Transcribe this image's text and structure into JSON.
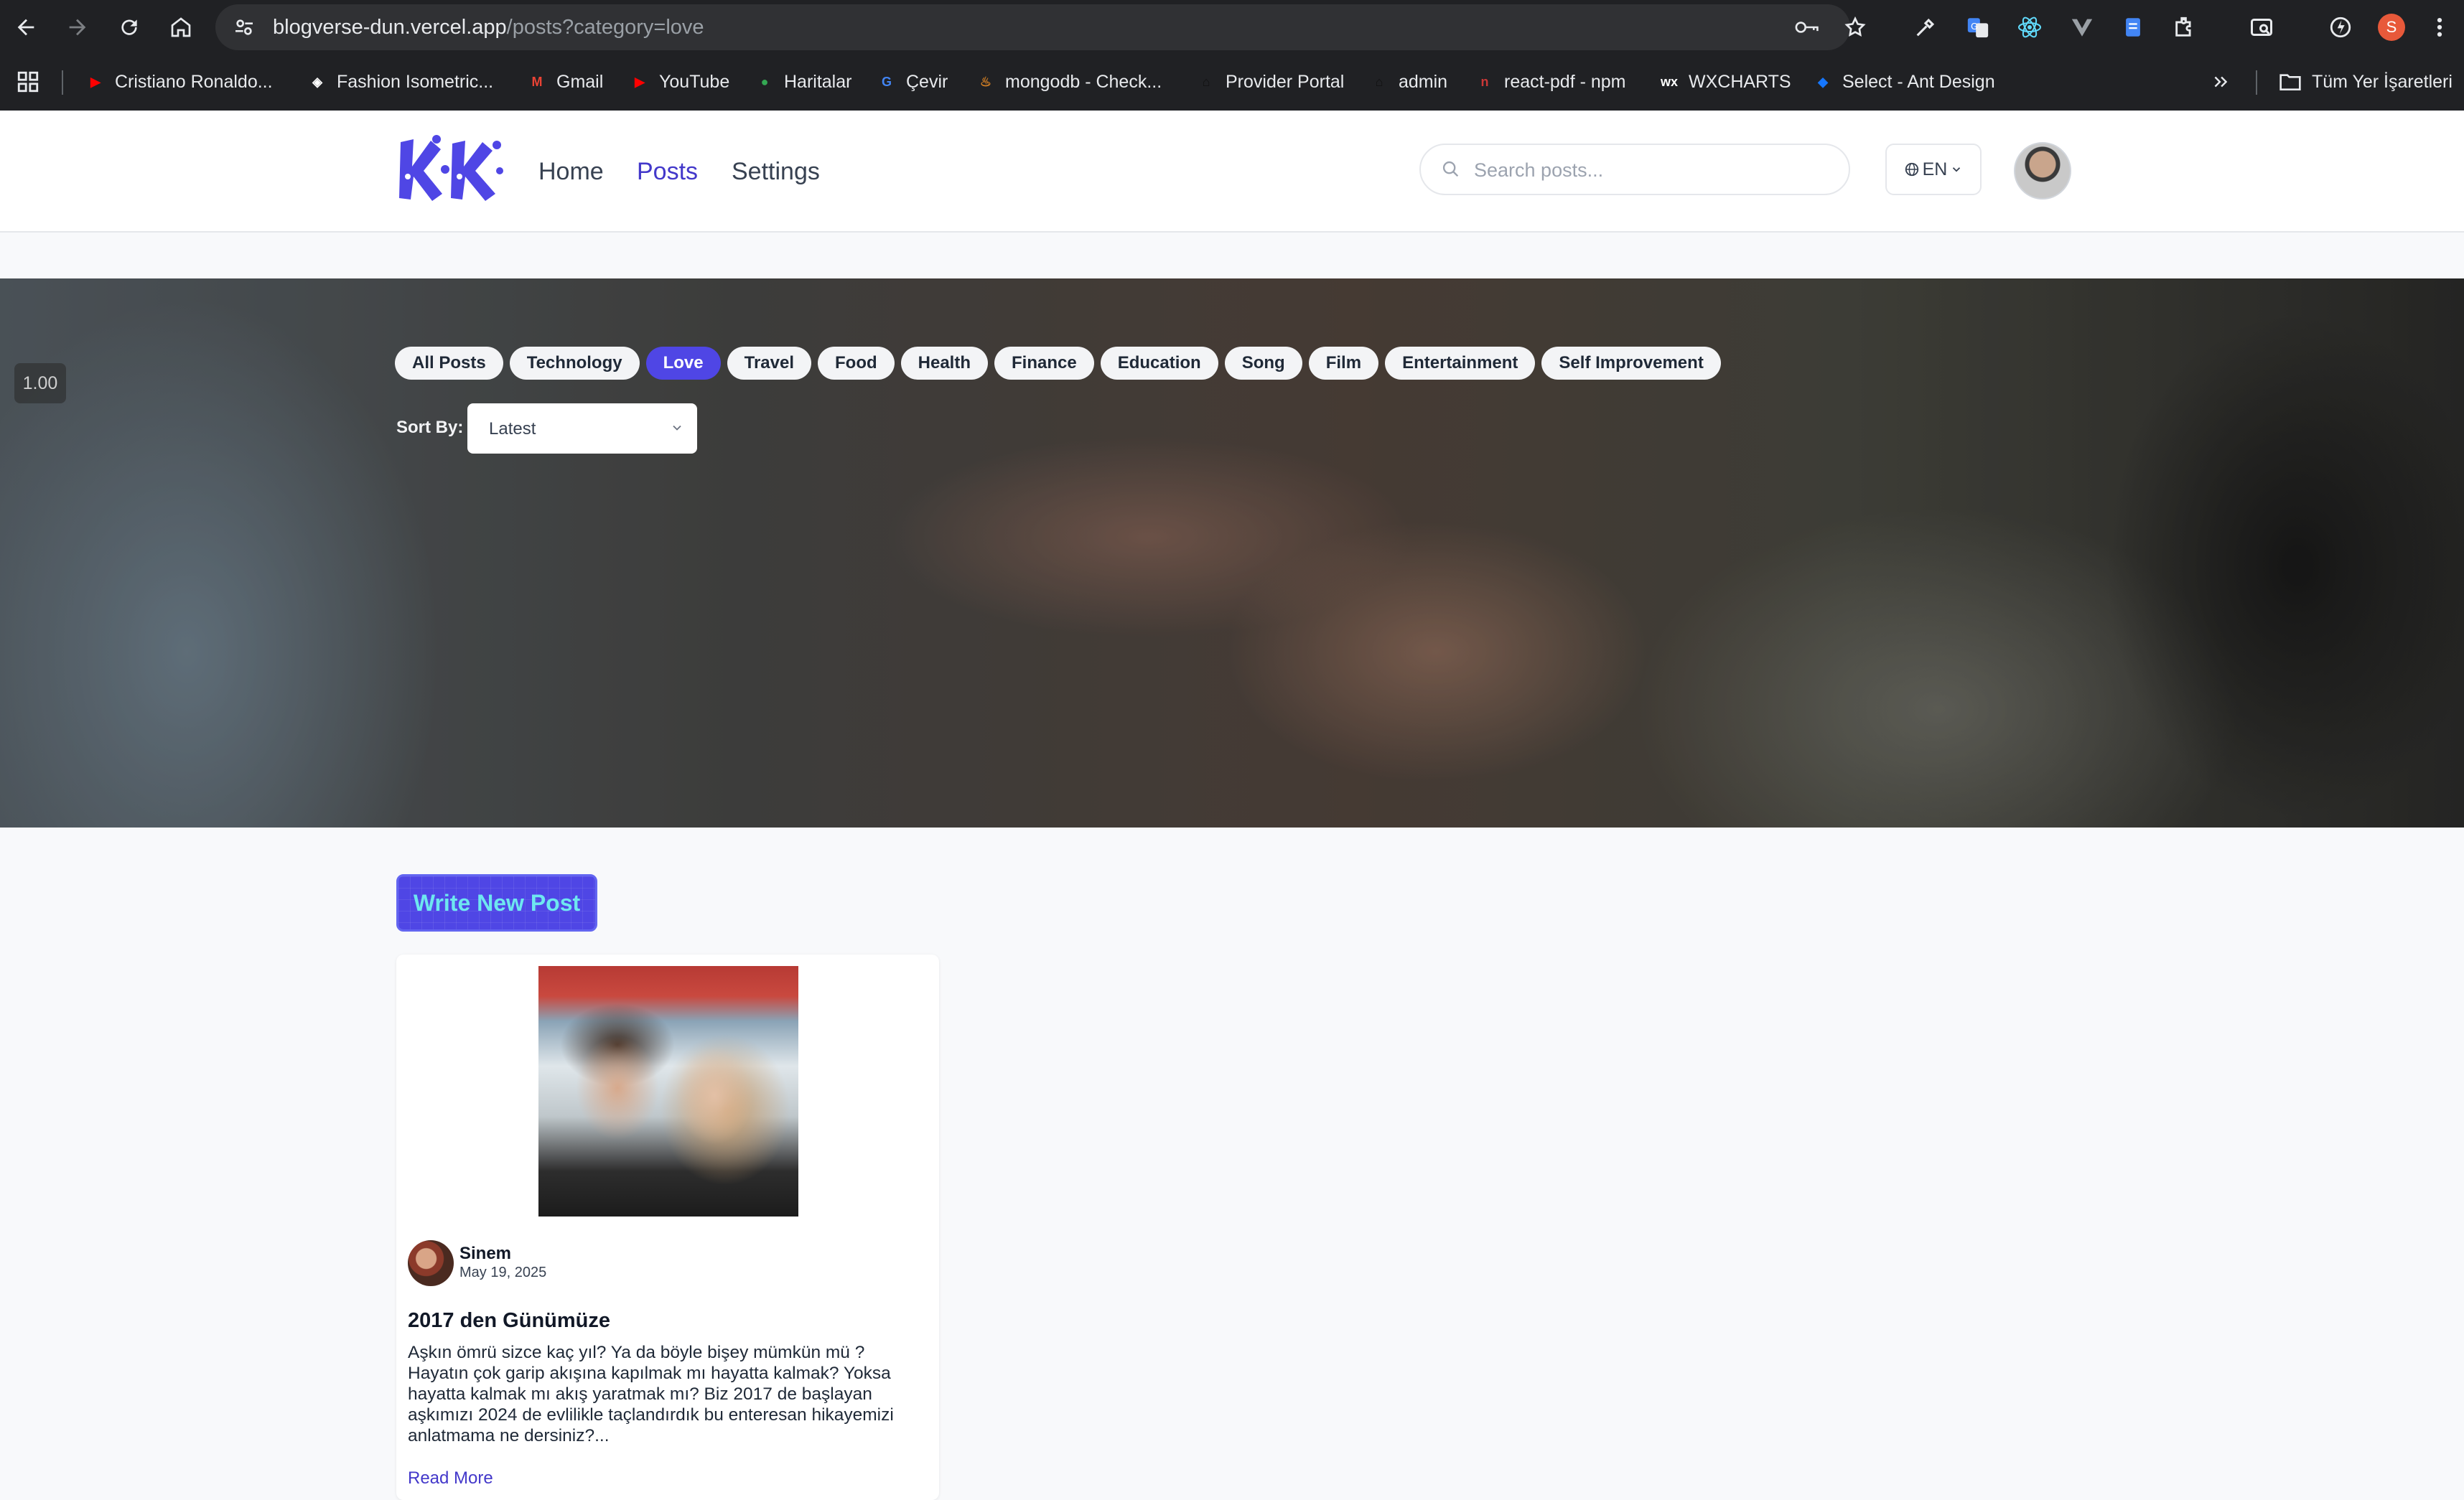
{
  "browser": {
    "url_host": "blogverse-dun.vercel.app",
    "url_path": "/posts?category=love",
    "bookmarks": [
      {
        "label": "Cristiano Ronaldo...",
        "icon": "youtube-icon",
        "color": "#ff0000"
      },
      {
        "label": "Fashion Isometric...",
        "icon": "fashion-icon",
        "color": "#ffffff"
      },
      {
        "label": "Gmail",
        "icon": "gmail-icon",
        "color": "#ea4335"
      },
      {
        "label": "YouTube",
        "icon": "youtube-icon",
        "color": "#ff0000"
      },
      {
        "label": "Haritalar",
        "icon": "maps-icon",
        "color": "#34a853"
      },
      {
        "label": "Çevir",
        "icon": "translate-icon",
        "color": "#4285f4"
      },
      {
        "label": "mongodb - Check...",
        "icon": "mongodb-icon",
        "color": "#d98324"
      },
      {
        "label": "Provider Portal",
        "icon": "home-icon",
        "color": "#111111"
      },
      {
        "label": "admin",
        "icon": "home-icon",
        "color": "#111111"
      },
      {
        "label": "react-pdf - npm",
        "icon": "npm-icon",
        "color": "#cb3837"
      },
      {
        "label": "WXCHARTS",
        "icon": "wx-icon",
        "color": "#ffffff"
      },
      {
        "label": "Select - Ant Design",
        "icon": "antd-icon",
        "color": "#1677ff"
      }
    ],
    "all_bookmarks_label": "Tüm Yer İşaretleri",
    "profile_initial": "S"
  },
  "header": {
    "nav": {
      "home": "Home",
      "posts": "Posts",
      "settings": "Settings"
    },
    "search_placeholder": "Search posts...",
    "language": "EN"
  },
  "hero": {
    "zoom": "1.00",
    "categories": [
      "All Posts",
      "Technology",
      "Love",
      "Travel",
      "Food",
      "Health",
      "Finance",
      "Education",
      "Song",
      "Film",
      "Entertainment",
      "Self Improvement"
    ],
    "active_category": "Love",
    "sort_label": "Sort By:",
    "sort_value": "Latest"
  },
  "main": {
    "write_button": "Write New Post",
    "posts": [
      {
        "author": "Sinem",
        "date": "May 19, 2025",
        "title": "2017 den Günümüze",
        "excerpt": "Aşkın ömrü sizce kaç yıl? Ya da böyle bişey mümkün mü ? Hayatın çok garip akışına kapılmak mı hayatta kalmak? Yoksa hayatta kalmak mı akış yaratmak mı? Biz 2017 de başlayan aşkımızı 2024 de evlilikle taçlandırdık bu enteresan hikayemizi anlatmama ne dersiniz?...",
        "read_more": "Read More"
      }
    ]
  },
  "colors": {
    "accent": "#4f46e5",
    "nav_active": "#4338ca",
    "chrome_bg": "#202124"
  }
}
